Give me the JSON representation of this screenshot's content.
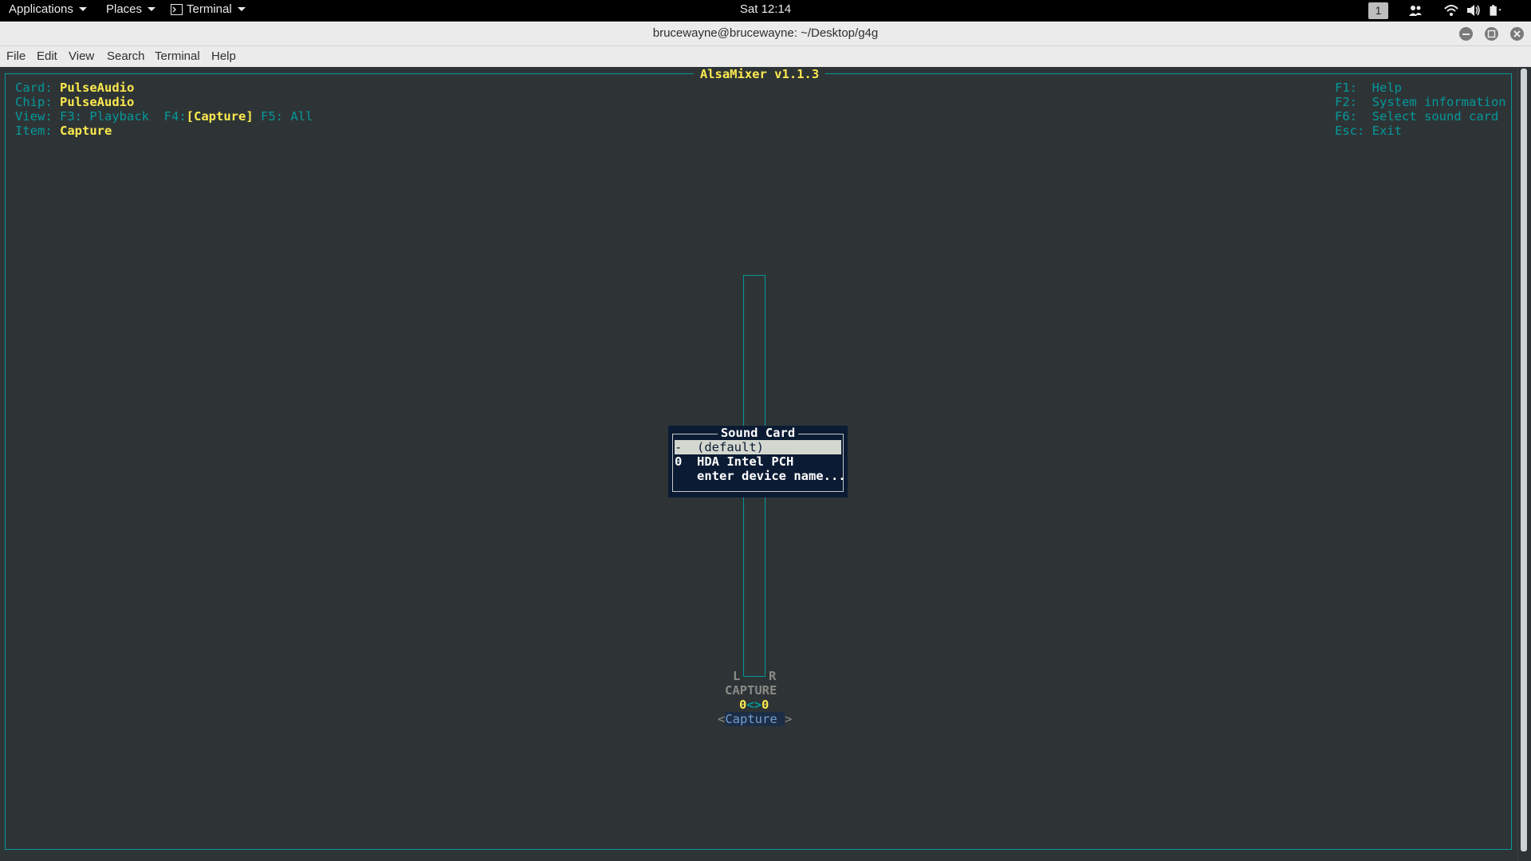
{
  "topbar": {
    "applications": "Applications",
    "places": "Places",
    "terminal": "Terminal",
    "clock": "Sat 12:14",
    "workspace": "1",
    "tray_icons": [
      "people-icon",
      "wifi-icon",
      "volume-icon",
      "battery-icon"
    ]
  },
  "window": {
    "title": "brucewayne@brucewayne: ~/Desktop/g4g",
    "menu": [
      "File",
      "Edit",
      "View",
      "Search",
      "Terminal",
      "Help"
    ]
  },
  "alsamixer": {
    "title": "AlsaMixer v1.1.3",
    "card_label": "Card:",
    "card_value": "PulseAudio",
    "chip_label": "Chip:",
    "chip_value": "PulseAudio",
    "view_label": "View:",
    "view_f3": "F3: Playback",
    "view_f4_key": "F4:",
    "view_f4_value": "[Capture]",
    "view_f5": "F5: All",
    "item_label": "Item:",
    "item_value": "Capture",
    "help": [
      {
        "key": "F1:",
        "text": "Help"
      },
      {
        "key": "F2:",
        "text": "System information"
      },
      {
        "key": "F6:",
        "text": "Select sound card"
      },
      {
        "key": "Esc:",
        "text": "Exit"
      }
    ],
    "control": {
      "left_marker": "L",
      "right_marker": "R",
      "name": "CAPTURE",
      "left_value": "0",
      "link": "<>",
      "right_value": "0",
      "switch_open": "<",
      "switch_label": "Capture",
      "switch_close": ">"
    },
    "dialog": {
      "title": "Sound Card",
      "options": [
        {
          "index": "-",
          "label": "(default)"
        },
        {
          "index": "0",
          "label": "HDA Intel PCH"
        },
        {
          "index": "",
          "label": "enter device name..."
        }
      ],
      "selected": 0
    }
  },
  "colors": {
    "terminal_bg": "#2e3436",
    "cyan": "#06989a",
    "yellow": "#fce94f",
    "dialog_bg": "#0b1b33"
  }
}
